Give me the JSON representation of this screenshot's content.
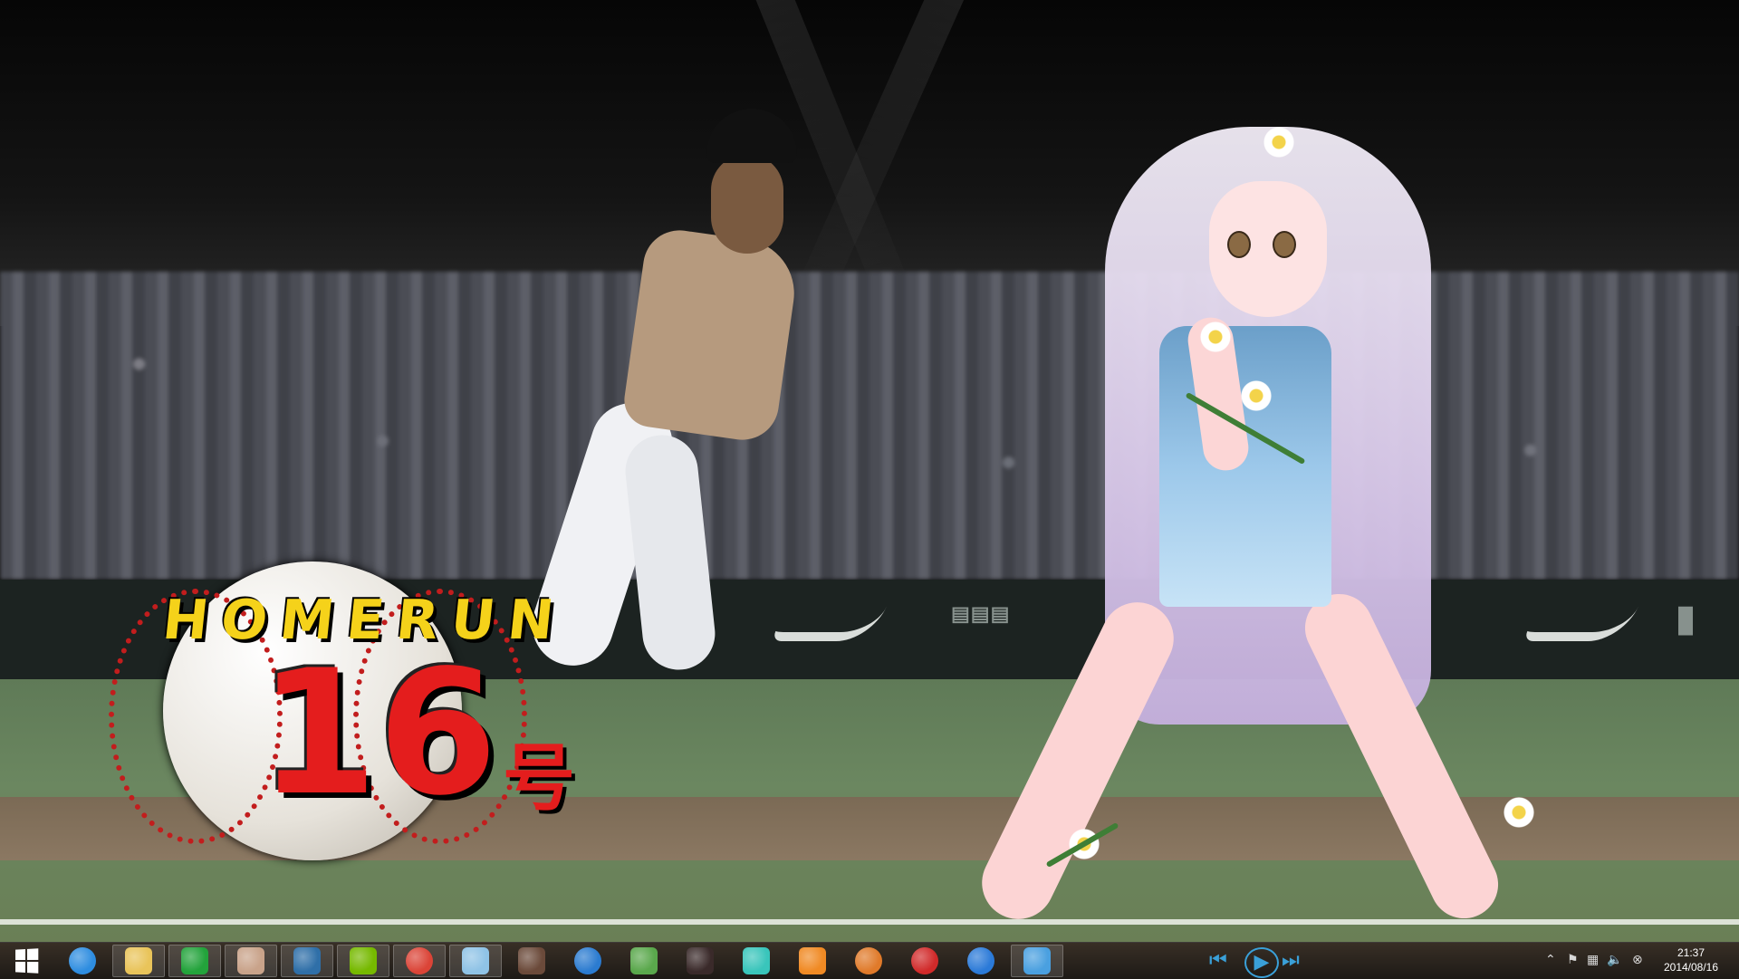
{
  "wallpaper": {
    "badge_word": "HOMERUN",
    "badge_number": "16",
    "badge_suffix": "号"
  },
  "taskbar": {
    "apps": [
      {
        "id": "start",
        "name": "start-icon"
      },
      {
        "id": "ie",
        "name": "internet-explorer-icon",
        "color": "#2e8de0"
      },
      {
        "id": "explorer",
        "name": "file-explorer-icon",
        "color": "#e9c45a",
        "active": true
      },
      {
        "id": "store",
        "name": "store-icon",
        "color": "#23a33b",
        "active": true
      },
      {
        "id": "app-girl1",
        "name": "character-app-icon",
        "color": "#c9a38a",
        "active": true
      },
      {
        "id": "app-blue",
        "name": "figure-app-icon",
        "color": "#2f6fa8",
        "active": true
      },
      {
        "id": "nvidia",
        "name": "nvidia-icon",
        "color": "#76b900",
        "active": true
      },
      {
        "id": "chrome",
        "name": "chrome-icon",
        "color": "#db4437",
        "active": true
      },
      {
        "id": "notepad",
        "name": "notepad-icon",
        "color": "#8fc3e6",
        "active": true
      },
      {
        "id": "app-girl2",
        "name": "character-app-icon",
        "color": "#6b4a3a"
      },
      {
        "id": "thunder",
        "name": "lightning-app-icon",
        "color": "#2b7bd0"
      },
      {
        "id": "editor",
        "name": "pen-app-icon",
        "color": "#5aa84c"
      },
      {
        "id": "app-girl3",
        "name": "character-app-icon",
        "color": "#3a2a2a"
      },
      {
        "id": "miku",
        "name": "miku-app-icon",
        "color": "#39c5bb"
      },
      {
        "id": "video",
        "name": "video-player-icon",
        "color": "#f08a24"
      },
      {
        "id": "monkey",
        "name": "monkey-app-icon",
        "color": "#e07a2a"
      },
      {
        "id": "red",
        "name": "red-app-icon",
        "color": "#d12a2a"
      },
      {
        "id": "music",
        "name": "music-player-icon",
        "color": "#2b7ad8"
      },
      {
        "id": "music2",
        "name": "music-note-icon",
        "color": "#4aa0e0",
        "active": true
      }
    ],
    "media": {
      "prev": "⏮",
      "play": "▶",
      "next": "⏭"
    },
    "tray": {
      "chevron": "⌃",
      "flag": "⚑",
      "network": "▦",
      "volume": "🔈",
      "close": "⊗"
    },
    "time": "21:37",
    "date": "2014/08/16"
  }
}
